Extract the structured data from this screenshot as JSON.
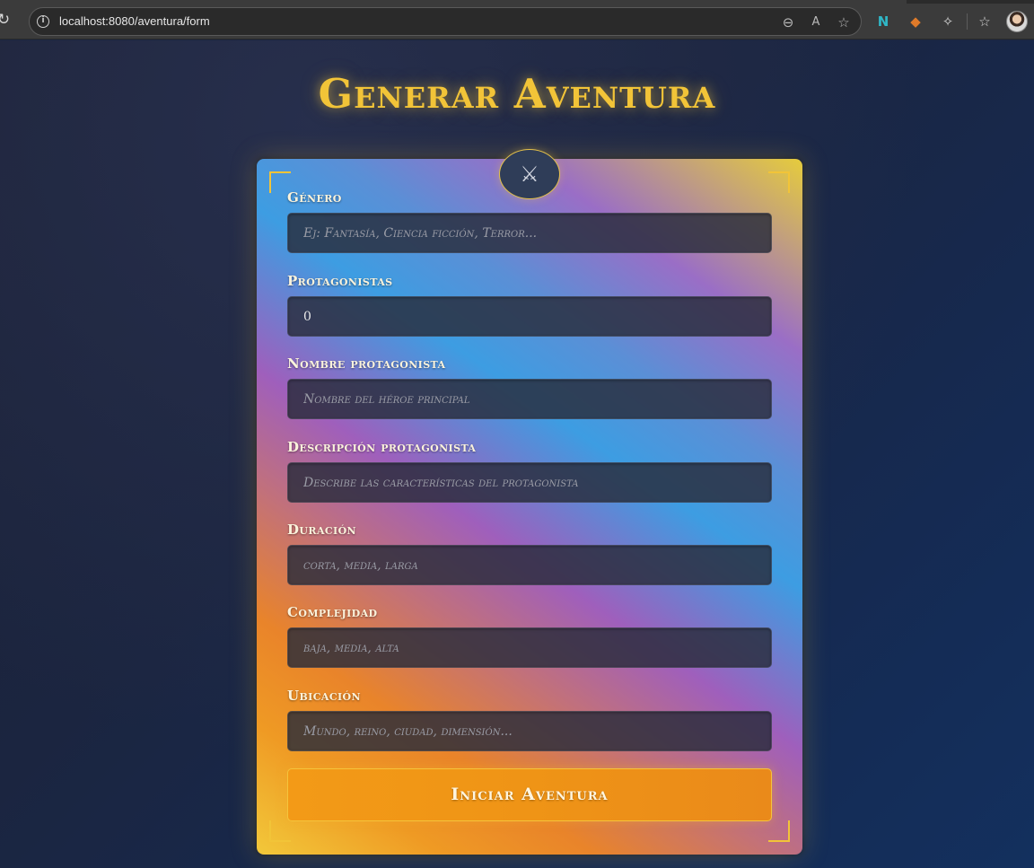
{
  "browser": {
    "url": "localhost:8080/aventura/form",
    "icons": {
      "reload": "reload-icon",
      "site_info": "info-icon",
      "zoom": "zoom-out-icon",
      "read_aloud": "read-aloud-icon",
      "favorite": "star-icon",
      "ext1": "n-extension-icon",
      "ext2": "fox-extension-icon",
      "extensions": "puzzle-icon",
      "favorites": "favorites-icon",
      "profile": "avatar"
    }
  },
  "page": {
    "title": "Generar Aventura",
    "emblem_icon": "crossed-swords-icon",
    "emblem_glyph": "⚔"
  },
  "form": {
    "fields": [
      {
        "label": "Género",
        "placeholder": "Ej: Fantasía, Ciencia ficción, Terror...",
        "value": ""
      },
      {
        "label": "Protagonistas",
        "placeholder": "",
        "value": "0"
      },
      {
        "label": "Nombre protagonista",
        "placeholder": "Nombre del héroe principal",
        "value": ""
      },
      {
        "label": "Descripción protagonista",
        "placeholder": "Describe las características del protagonista",
        "value": ""
      },
      {
        "label": "Duración",
        "placeholder": "corta, media, larga",
        "value": ""
      },
      {
        "label": "Complejidad",
        "placeholder": "baja, media, alta",
        "value": ""
      },
      {
        "label": "Ubicación",
        "placeholder": "Mundo, reino, ciudad, dimensión...",
        "value": ""
      }
    ],
    "submit_label": "Iniciar Aventura"
  },
  "colors": {
    "accent_gold": "#f2c438",
    "button_orange": "#f39a17",
    "background": "#1b2540"
  }
}
